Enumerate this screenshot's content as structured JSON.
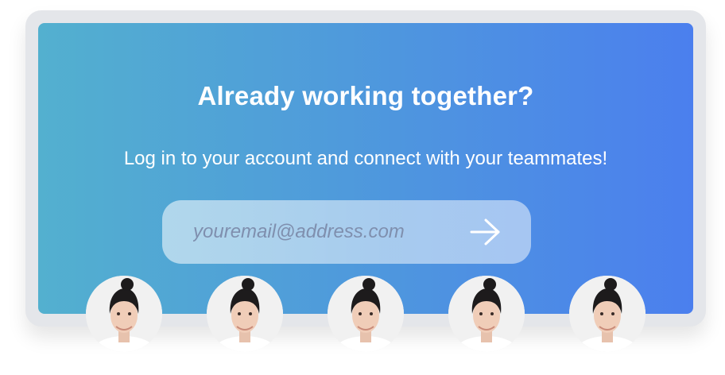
{
  "signup": {
    "heading": "Already working together?",
    "subtext": "Log in to your account and connect with your teammates!",
    "email_placeholder": "youremail@address.com",
    "email_value": "",
    "submit_icon": "arrow-right-icon"
  },
  "teammates": [
    {
      "avatar": "teammate-photo"
    },
    {
      "avatar": "teammate-photo"
    },
    {
      "avatar": "teammate-photo"
    },
    {
      "avatar": "teammate-photo"
    },
    {
      "avatar": "teammate-photo"
    }
  ],
  "colors": {
    "gradient_start": "#53b0cf",
    "gradient_end": "#4b7fee",
    "frame": "#e4e6ea",
    "text": "#ffffff"
  }
}
